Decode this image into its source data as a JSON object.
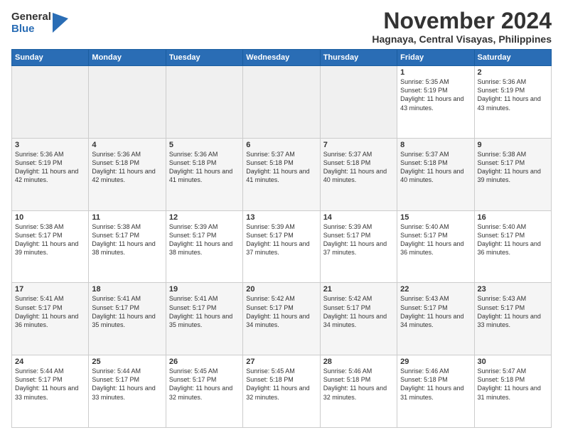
{
  "logo": {
    "general": "General",
    "blue": "Blue"
  },
  "title": "November 2024",
  "location": "Hagnaya, Central Visayas, Philippines",
  "days_header": [
    "Sunday",
    "Monday",
    "Tuesday",
    "Wednesday",
    "Thursday",
    "Friday",
    "Saturday"
  ],
  "weeks": [
    [
      {
        "day": "",
        "info": ""
      },
      {
        "day": "",
        "info": ""
      },
      {
        "day": "",
        "info": ""
      },
      {
        "day": "",
        "info": ""
      },
      {
        "day": "",
        "info": ""
      },
      {
        "day": "1",
        "info": "Sunrise: 5:35 AM\nSunset: 5:19 PM\nDaylight: 11 hours\nand 43 minutes."
      },
      {
        "day": "2",
        "info": "Sunrise: 5:36 AM\nSunset: 5:19 PM\nDaylight: 11 hours\nand 43 minutes."
      }
    ],
    [
      {
        "day": "3",
        "info": "Sunrise: 5:36 AM\nSunset: 5:19 PM\nDaylight: 11 hours\nand 42 minutes."
      },
      {
        "day": "4",
        "info": "Sunrise: 5:36 AM\nSunset: 5:18 PM\nDaylight: 11 hours\nand 42 minutes."
      },
      {
        "day": "5",
        "info": "Sunrise: 5:36 AM\nSunset: 5:18 PM\nDaylight: 11 hours\nand 41 minutes."
      },
      {
        "day": "6",
        "info": "Sunrise: 5:37 AM\nSunset: 5:18 PM\nDaylight: 11 hours\nand 41 minutes."
      },
      {
        "day": "7",
        "info": "Sunrise: 5:37 AM\nSunset: 5:18 PM\nDaylight: 11 hours\nand 40 minutes."
      },
      {
        "day": "8",
        "info": "Sunrise: 5:37 AM\nSunset: 5:18 PM\nDaylight: 11 hours\nand 40 minutes."
      },
      {
        "day": "9",
        "info": "Sunrise: 5:38 AM\nSunset: 5:17 PM\nDaylight: 11 hours\nand 39 minutes."
      }
    ],
    [
      {
        "day": "10",
        "info": "Sunrise: 5:38 AM\nSunset: 5:17 PM\nDaylight: 11 hours\nand 39 minutes."
      },
      {
        "day": "11",
        "info": "Sunrise: 5:38 AM\nSunset: 5:17 PM\nDaylight: 11 hours\nand 38 minutes."
      },
      {
        "day": "12",
        "info": "Sunrise: 5:39 AM\nSunset: 5:17 PM\nDaylight: 11 hours\nand 38 minutes."
      },
      {
        "day": "13",
        "info": "Sunrise: 5:39 AM\nSunset: 5:17 PM\nDaylight: 11 hours\nand 37 minutes."
      },
      {
        "day": "14",
        "info": "Sunrise: 5:39 AM\nSunset: 5:17 PM\nDaylight: 11 hours\nand 37 minutes."
      },
      {
        "day": "15",
        "info": "Sunrise: 5:40 AM\nSunset: 5:17 PM\nDaylight: 11 hours\nand 36 minutes."
      },
      {
        "day": "16",
        "info": "Sunrise: 5:40 AM\nSunset: 5:17 PM\nDaylight: 11 hours\nand 36 minutes."
      }
    ],
    [
      {
        "day": "17",
        "info": "Sunrise: 5:41 AM\nSunset: 5:17 PM\nDaylight: 11 hours\nand 36 minutes."
      },
      {
        "day": "18",
        "info": "Sunrise: 5:41 AM\nSunset: 5:17 PM\nDaylight: 11 hours\nand 35 minutes."
      },
      {
        "day": "19",
        "info": "Sunrise: 5:41 AM\nSunset: 5:17 PM\nDaylight: 11 hours\nand 35 minutes."
      },
      {
        "day": "20",
        "info": "Sunrise: 5:42 AM\nSunset: 5:17 PM\nDaylight: 11 hours\nand 34 minutes."
      },
      {
        "day": "21",
        "info": "Sunrise: 5:42 AM\nSunset: 5:17 PM\nDaylight: 11 hours\nand 34 minutes."
      },
      {
        "day": "22",
        "info": "Sunrise: 5:43 AM\nSunset: 5:17 PM\nDaylight: 11 hours\nand 34 minutes."
      },
      {
        "day": "23",
        "info": "Sunrise: 5:43 AM\nSunset: 5:17 PM\nDaylight: 11 hours\nand 33 minutes."
      }
    ],
    [
      {
        "day": "24",
        "info": "Sunrise: 5:44 AM\nSunset: 5:17 PM\nDaylight: 11 hours\nand 33 minutes."
      },
      {
        "day": "25",
        "info": "Sunrise: 5:44 AM\nSunset: 5:17 PM\nDaylight: 11 hours\nand 33 minutes."
      },
      {
        "day": "26",
        "info": "Sunrise: 5:45 AM\nSunset: 5:17 PM\nDaylight: 11 hours\nand 32 minutes."
      },
      {
        "day": "27",
        "info": "Sunrise: 5:45 AM\nSunset: 5:18 PM\nDaylight: 11 hours\nand 32 minutes."
      },
      {
        "day": "28",
        "info": "Sunrise: 5:46 AM\nSunset: 5:18 PM\nDaylight: 11 hours\nand 32 minutes."
      },
      {
        "day": "29",
        "info": "Sunrise: 5:46 AM\nSunset: 5:18 PM\nDaylight: 11 hours\nand 31 minutes."
      },
      {
        "day": "30",
        "info": "Sunrise: 5:47 AM\nSunset: 5:18 PM\nDaylight: 11 hours\nand 31 minutes."
      }
    ]
  ]
}
